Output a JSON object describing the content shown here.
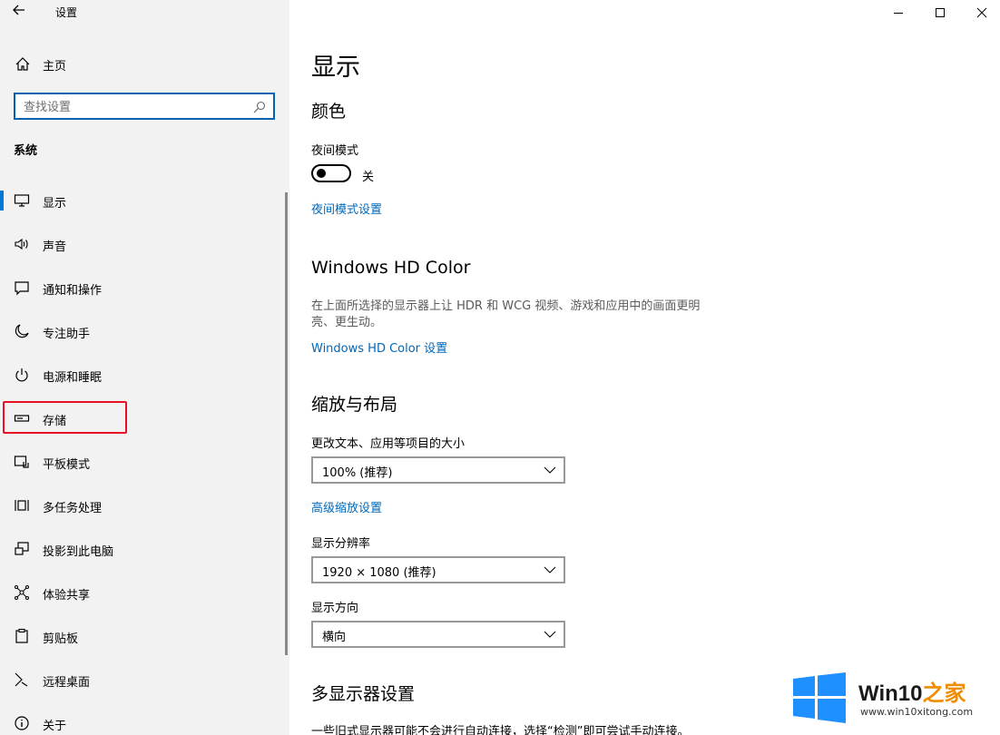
{
  "window": {
    "title": "设置"
  },
  "sidebar": {
    "home_label": "主页",
    "search_placeholder": "查找设置",
    "section_label": "系统",
    "items": [
      {
        "label": "显示",
        "icon": "monitor-icon"
      },
      {
        "label": "声音",
        "icon": "speaker-icon"
      },
      {
        "label": "通知和操作",
        "icon": "notification-icon"
      },
      {
        "label": "专注助手",
        "icon": "moon-icon"
      },
      {
        "label": "电源和睡眠",
        "icon": "power-icon"
      },
      {
        "label": "存储",
        "icon": "storage-icon"
      },
      {
        "label": "平板模式",
        "icon": "tablet-icon"
      },
      {
        "label": "多任务处理",
        "icon": "multitask-icon"
      },
      {
        "label": "投影到此电脑",
        "icon": "project-icon"
      },
      {
        "label": "体验共享",
        "icon": "share-icon"
      },
      {
        "label": "剪贴板",
        "icon": "clipboard-icon"
      },
      {
        "label": "远程桌面",
        "icon": "remote-icon"
      },
      {
        "label": "关于",
        "icon": "info-icon"
      }
    ]
  },
  "main": {
    "page_title": "显示",
    "color_section": {
      "heading": "颜色",
      "night_mode_label": "夜间模式",
      "night_mode_state": "关",
      "night_mode_settings_link": "夜间模式设置"
    },
    "hd_color_section": {
      "heading": "Windows HD Color",
      "description": "在上面所选择的显示器上让 HDR 和 WCG 视频、游戏和应用中的画面更明亮、更生动。",
      "settings_link": "Windows HD Color 设置"
    },
    "scale_section": {
      "heading": "缩放与布局",
      "scale_label": "更改文本、应用等项目的大小",
      "scale_value": "100% (推荐)",
      "advanced_link": "高级缩放设置",
      "resolution_label": "显示分辨率",
      "resolution_value": "1920 × 1080 (推荐)",
      "orientation_label": "显示方向",
      "orientation_value": "横向"
    },
    "multi_display_section": {
      "heading": "多显示器设置",
      "description": "一些旧式显示器可能不会进行自动连接，选择“检测”即可尝试手动连接。"
    }
  },
  "watermark": {
    "brand_prefix": "Win10",
    "brand_suffix": "之家",
    "url": "www.win10xitong.com"
  },
  "colors": {
    "accent": "#0078d7",
    "link": "#0067b8",
    "highlight": "#e81123"
  }
}
